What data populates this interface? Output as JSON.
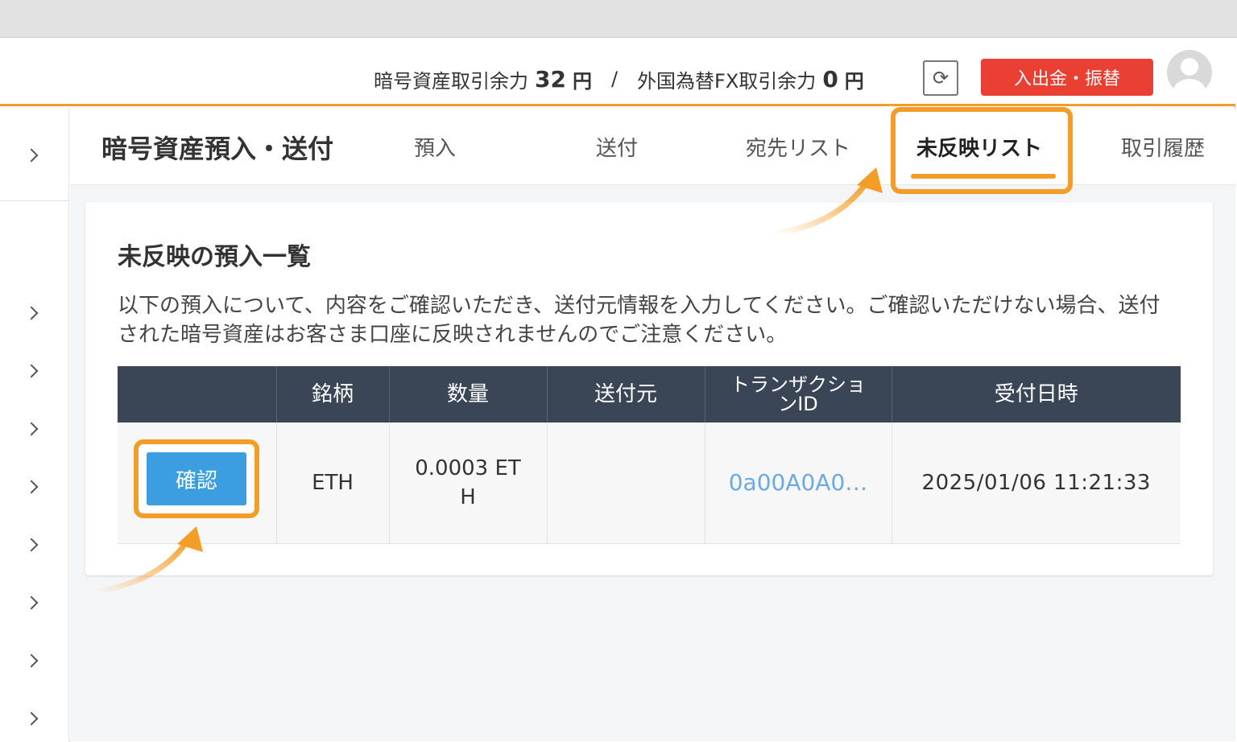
{
  "header": {
    "crypto_margin_label": "暗号資産取引余力",
    "crypto_margin_value": "32",
    "crypto_margin_unit": "円",
    "separator": "/",
    "fx_margin_label": "外国為替FX取引余力",
    "fx_margin_value": "0",
    "fx_margin_unit": "円",
    "refresh_icon": "⟳",
    "deposit_button": "入出金・振替"
  },
  "page": {
    "title": "暗号資産預入・送付",
    "tabs": [
      {
        "label": "預入"
      },
      {
        "label": "送付"
      },
      {
        "label": "宛先リスト"
      },
      {
        "label": "未反映リスト"
      },
      {
        "label": "取引履歴"
      }
    ]
  },
  "card": {
    "title": "未反映の預入一覧",
    "description": "以下の預入について、内容をご確認いただき、送付元情報を入力してください。ご確認いただけない場合、送付された暗号資産はお客さま口座に反映されませんのでご注意ください。",
    "table": {
      "headers": [
        "",
        "銘柄",
        "数量",
        "送付元",
        "トランザクションID",
        "受付日時"
      ],
      "rows": [
        {
          "action": "確認",
          "symbol": "ETH",
          "quantity": "0.0003 ETH",
          "from": "",
          "txid": "0a00A0A0…",
          "datetime": "2025/01/06 11:21:33"
        }
      ]
    }
  },
  "colors": {
    "accent": "#f39c27",
    "header_table": "#3a4656",
    "confirm_button": "#3a9ee0",
    "deposit_button": "#e94033",
    "link": "#6aa8e6"
  }
}
